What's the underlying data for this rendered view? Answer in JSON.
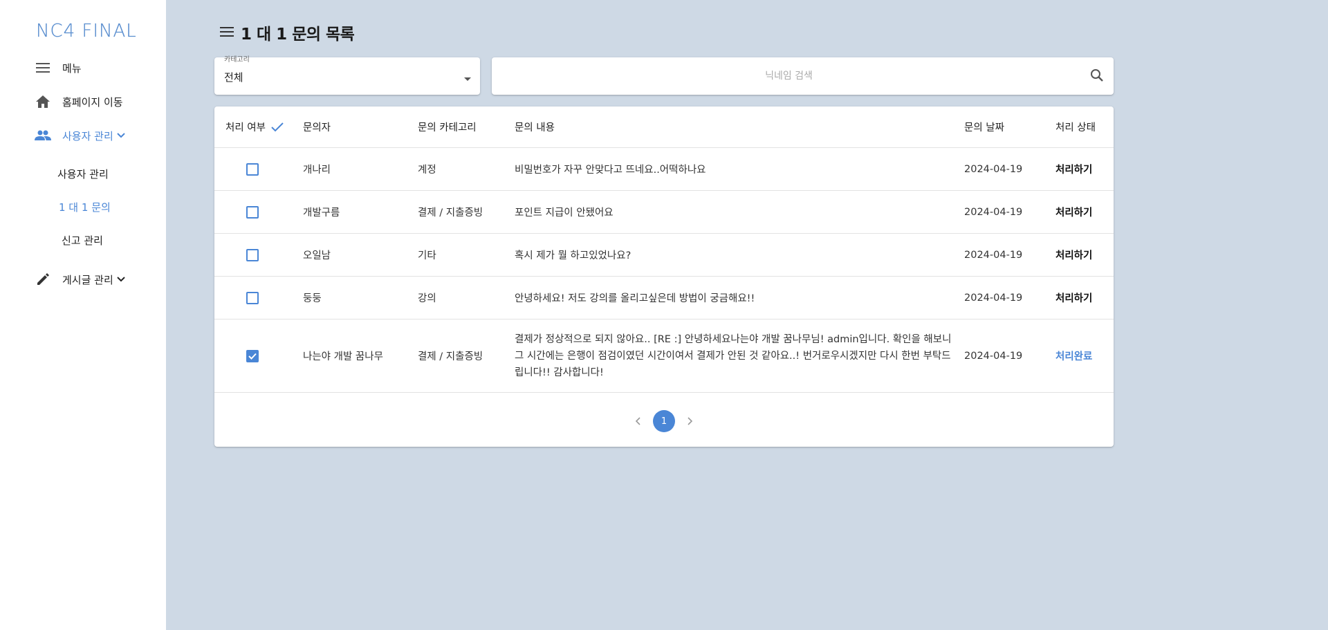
{
  "sidebar": {
    "logo": "NC4 FINAL",
    "items": [
      {
        "label": "메뉴",
        "icon": "menu-icon"
      },
      {
        "label": "홈페이지 이동",
        "icon": "home-icon"
      },
      {
        "label": "사용자 관리",
        "icon": "people-icon",
        "expanded": true
      },
      {
        "label": "게시글 관리",
        "icon": "pencil-icon",
        "expanded": false
      }
    ],
    "sub_items": [
      {
        "label": "사용자 관리"
      },
      {
        "label": "1 대 1 문의",
        "active": true
      },
      {
        "label": "신고 관리"
      }
    ]
  },
  "page": {
    "title": "1 대 1 문의 목록"
  },
  "filter": {
    "category_label": "카테고리",
    "category_value": "전체",
    "search_placeholder": "닉네임 검색"
  },
  "table": {
    "headers": [
      "처리 여부",
      "문의자",
      "문의 카테고리",
      "문의 내용",
      "문의 날짜",
      "처리 상태"
    ],
    "rows": [
      {
        "checked": false,
        "user": "개나리",
        "category": "계정",
        "content": "비밀번호가 자꾸 안맞다고 뜨네요..어떡하나요",
        "date": "2024-04-19",
        "status": "처리하기"
      },
      {
        "checked": false,
        "user": "개발구름",
        "category": "결제 / 지출증빙",
        "content": "포인트 지급이 안됐어요",
        "date": "2024-04-19",
        "status": "처리하기"
      },
      {
        "checked": false,
        "user": "오일남",
        "category": "기타",
        "content": "혹시 제가 뭘 하고있었나요?",
        "date": "2024-04-19",
        "status": "처리하기"
      },
      {
        "checked": false,
        "user": "둥둥",
        "category": "강의",
        "content": "안녕하세요! 저도 강의를 올리고싶은데 방법이 궁금해요!!",
        "date": "2024-04-19",
        "status": "처리하기"
      },
      {
        "checked": true,
        "user": "나는야 개발 꿈나무",
        "category": "결제 / 지출증빙",
        "content": "결제가 정상적으로 되지 않아요.. [RE :] 안녕하세요나는야 개발 꿈나무님! admin입니다. 확인을 해보니 그 시간에는 은행이 점검이였던 시간이여서 결제가 안된 것 같아요..! 번거로우시겠지만 다시 한번 부탁드립니다!! 감사합니다!",
        "date": "2024-04-19",
        "status": "처리완료"
      }
    ]
  },
  "pagination": {
    "current": "1"
  },
  "colors": {
    "accent": "#4a86d6",
    "background": "#ced9e5"
  }
}
